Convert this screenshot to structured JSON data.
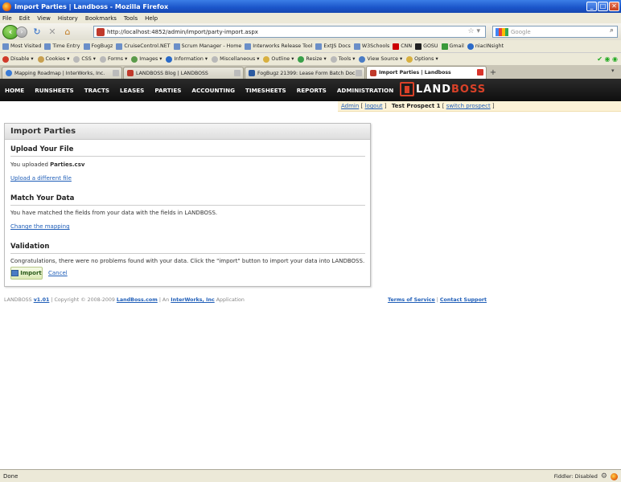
{
  "window": {
    "title": "Import Parties | Landboss - Mozilla Firefox",
    "buttons": {
      "minimize": "_",
      "maximize": "□",
      "close": "✕"
    }
  },
  "menubar": [
    "File",
    "Edit",
    "View",
    "History",
    "Bookmarks",
    "Tools",
    "Help"
  ],
  "navigation": {
    "url": "http://localhost:4852/admin/import/party-import.aspx",
    "search_placeholder": "Google"
  },
  "bookmarks": [
    "Most Visited",
    "Time Entry",
    "FogBugz",
    "CruiseControl.NET",
    "Scrum Manager - Home",
    "Interworks Release Tool",
    "ExtJS Docs",
    "W3Schools",
    "CNN",
    "GOSU",
    "Gmail",
    "niacINsight"
  ],
  "devtoolbar": [
    "Disable",
    "Cookies",
    "CSS",
    "Forms",
    "Images",
    "Information",
    "Miscellaneous",
    "Outline",
    "Resize",
    "Tools",
    "View Source",
    "Options"
  ],
  "tabs": [
    {
      "label": "Mapping Roadmap | InterWorks, Inc.",
      "active": false,
      "icon_color": "#3a7bd5"
    },
    {
      "label": "LANDBOSS Blog | LANDBOSS",
      "active": false,
      "icon_color": "#c0392b"
    },
    {
      "label": "FogBugz 21399: Lease Form Batch Doc...",
      "active": false,
      "icon_color": "#2c5aa0"
    },
    {
      "label": "Import Parties | Landboss",
      "active": true,
      "icon_color": "#c0392b"
    }
  ],
  "app": {
    "nav": [
      "HOME",
      "RUNSHEETS",
      "TRACTS",
      "LEASES",
      "PARTIES",
      "ACCOUNTING",
      "TIMESHEETS",
      "REPORTS",
      "ADMINISTRATION"
    ],
    "logo": {
      "part1": "LAND",
      "part2": "BOSS"
    },
    "userbar": {
      "user": "Admin",
      "logout": "logout",
      "prospect": "Test Prospect 1",
      "switch": "switch prospect"
    },
    "panel": {
      "title": "Import Parties",
      "upload": {
        "heading": "Upload Your File",
        "text_prefix": "You uploaded",
        "filename": "Parties.csv",
        "link": "Upload a different file"
      },
      "match": {
        "heading": "Match Your Data",
        "text": "You have matched the fields from your data with the fields in LANDBOSS.",
        "link": "Change the mapping"
      },
      "validation": {
        "heading": "Validation",
        "text": "Congratulations, there were no problems found with your data. Click the \"import\" button to import your data into LANDBOSS."
      },
      "import_label": "Import",
      "cancel_label": "Cancel"
    },
    "footer": {
      "brand": "LANDBOSS",
      "version": "v1.01",
      "copyright": "| Copyright © 2008-2009",
      "site": "LandBoss.com",
      "by": "| An",
      "company": "InterWorks, Inc",
      "suffix": "Application",
      "terms": "Terms of Service",
      "contact": "Contact Support"
    }
  },
  "status": {
    "text": "Done",
    "fiddler": "Fiddler: Disabled"
  }
}
